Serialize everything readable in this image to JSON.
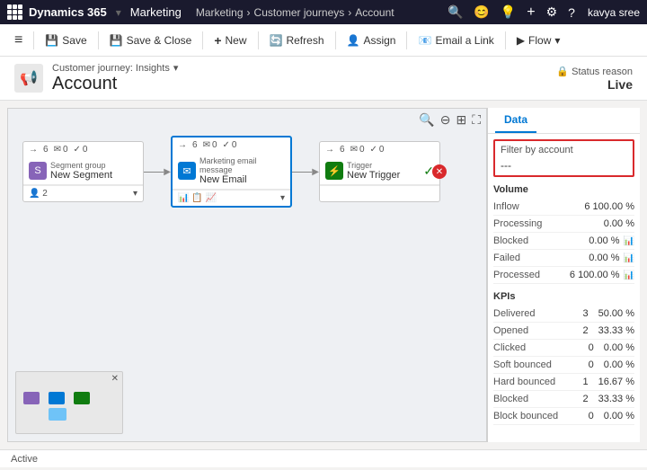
{
  "app": {
    "name": "Dynamics 365",
    "module": "Marketing",
    "dropdown_arrow": "▾"
  },
  "breadcrumb": {
    "items": [
      "Marketing",
      "Customer journeys",
      "Account"
    ],
    "separator": "›"
  },
  "nav_icons": [
    "🔍",
    "😊",
    "💡",
    "+",
    "⚙",
    "?"
  ],
  "user": "kavya sree",
  "command_bar": {
    "hamburger": "≡",
    "buttons": [
      {
        "icon": "💾",
        "label": "Save"
      },
      {
        "icon": "💾",
        "label": "Save & Close"
      },
      {
        "icon": "+",
        "label": "New"
      },
      {
        "icon": "🔄",
        "label": "Refresh"
      },
      {
        "icon": "👤",
        "label": "Assign"
      },
      {
        "icon": "📧",
        "label": "Email a Link"
      },
      {
        "icon": "▶",
        "label": "Flow"
      }
    ]
  },
  "header": {
    "icon": "📢",
    "subtitle": "Customer journey: Insights",
    "title": "Account",
    "status_label": "Status reason",
    "status_value": "Live"
  },
  "nodes": [
    {
      "id": "segment",
      "type": "Segment group",
      "name": "New Segment",
      "icon_color": "purple",
      "icon_text": "S",
      "stats": {
        "count": "6",
        "mail": "0",
        "check": "0"
      },
      "footer_value": "2",
      "has_check": false
    },
    {
      "id": "email",
      "type": "Marketing email message",
      "name": "New Email",
      "icon_color": "blue",
      "icon_text": "✉",
      "stats": {
        "count": "6",
        "mail": "0",
        "check": "0"
      },
      "footer_value": "",
      "has_check": false,
      "selected": true
    },
    {
      "id": "trigger",
      "type": "Trigger",
      "name": "New Trigger",
      "icon_color": "green",
      "icon_text": "⚡",
      "stats": {
        "count": "6",
        "mail": "0",
        "check": "0"
      },
      "footer_value": "",
      "has_check": true
    }
  ],
  "right_panel": {
    "tabs": [
      "Data"
    ],
    "filter": {
      "label": "Filter by account",
      "value": "---"
    },
    "volume": {
      "title": "Volume",
      "metrics": [
        {
          "label": "Inflow",
          "value": "6 100.00 %",
          "icon": false
        },
        {
          "label": "Processing",
          "value": "0.00 %",
          "icon": false
        },
        {
          "label": "Blocked",
          "value": "0.00 %",
          "icon": true
        },
        {
          "label": "Failed",
          "value": "0.00 %",
          "icon": true
        },
        {
          "label": "Processed",
          "value": "6 100.00 %",
          "icon": true
        }
      ]
    },
    "kpis": {
      "title": "KPIs",
      "metrics": [
        {
          "label": "Delivered",
          "value": "3",
          "pct": "50.00 %"
        },
        {
          "label": "Opened",
          "value": "2",
          "pct": "33.33 %"
        },
        {
          "label": "Clicked",
          "value": "0",
          "pct": "0.00 %"
        },
        {
          "label": "Soft bounced",
          "value": "0",
          "pct": "0.00 %"
        },
        {
          "label": "Hard bounced",
          "value": "1",
          "pct": "16.67 %"
        },
        {
          "label": "Blocked",
          "value": "2",
          "pct": "33.33 %"
        },
        {
          "label": "Block bounced",
          "value": "0",
          "pct": "0.00 %"
        }
      ]
    }
  },
  "status_bar": {
    "status": "Active"
  }
}
